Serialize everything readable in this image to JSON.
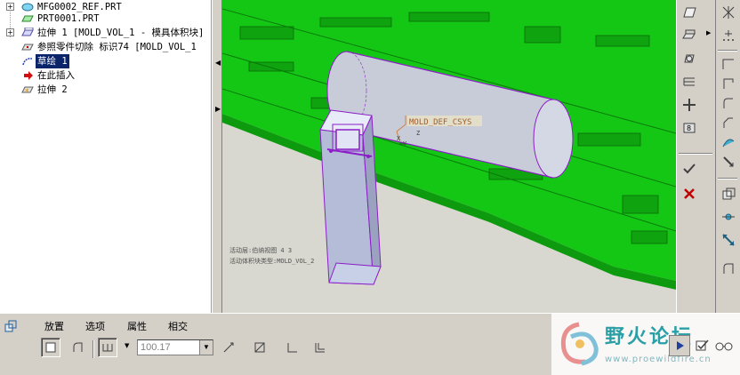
{
  "model_tree": {
    "items": [
      {
        "label": "MFG0002_REF.PRT",
        "icon": "part-icon",
        "expander": "+"
      },
      {
        "label": "PRT0001.PRT",
        "icon": "workpiece-icon",
        "expander": ""
      },
      {
        "label": "拉伸 1 [MOLD_VOL_1 - 模具体积块]",
        "icon": "extrude-icon",
        "expander": "+"
      },
      {
        "label": "参照零件切除 标识74 [MOLD_VOL_1",
        "icon": "cutout-icon",
        "expander": ""
      },
      {
        "label": "草绘 1",
        "icon": "sketch-icon",
        "expander": "",
        "selected": true
      },
      {
        "label": "在此插入",
        "icon": "insert-here-arrow-icon",
        "expander": ""
      },
      {
        "label": "拉伸 2",
        "icon": "extrude-new-icon",
        "expander": ""
      }
    ]
  },
  "viewport": {
    "csys_label": "MOLD_DEF_CSYS",
    "axis_x": "X",
    "axis_y": "Y",
    "axis_z": "Z",
    "info_line1": "活动层:伯纳视图 4 3",
    "info_line2": "活动体积块类型:MOLD_VOL_2",
    "colors": {
      "mold_base": "#15c715",
      "cylinder": "#c8ccd8",
      "extrude_box": "#b4bcd8",
      "sketch_outline": "#8c1ec8",
      "background": "#e6e6e0"
    }
  },
  "dashboard": {
    "tabs": [
      "放置",
      "选项",
      "属性",
      "相交"
    ],
    "depth_value": "100.17"
  },
  "watermark": {
    "title": "野火论坛",
    "url": "www.proewildfire.cn"
  }
}
